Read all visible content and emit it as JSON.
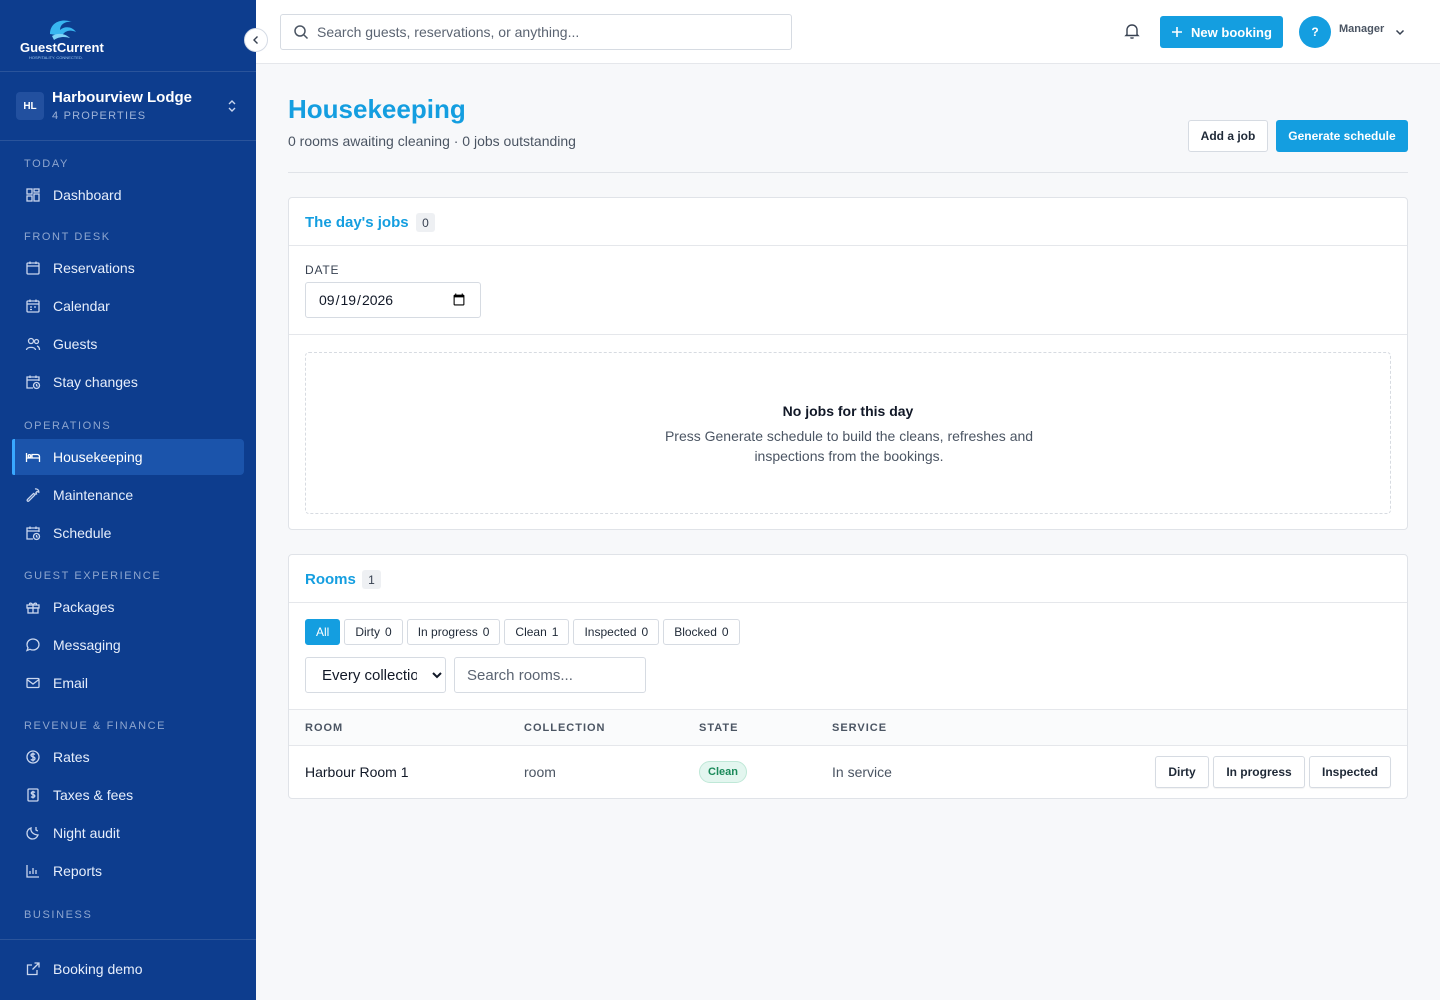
{
  "brand": {
    "name": "GuestCurrent",
    "tagline": "HOSPITALITY. CONNECTED."
  },
  "property": {
    "initials": "HL",
    "name": "Harbourview Lodge",
    "sub": "4 PROPERTIES"
  },
  "nav": {
    "today": "TODAY",
    "dashboard": "Dashboard",
    "front_desk": "FRONT DESK",
    "reservations": "Reservations",
    "calendar": "Calendar",
    "guests": "Guests",
    "stay_changes": "Stay changes",
    "operations": "OPERATIONS",
    "housekeeping": "Housekeeping",
    "maintenance": "Maintenance",
    "schedule": "Schedule",
    "guest_experience": "GUEST EXPERIENCE",
    "packages": "Packages",
    "messaging": "Messaging",
    "email": "Email",
    "revenue_finance": "REVENUE & FINANCE",
    "rates": "Rates",
    "taxes_fees": "Taxes & fees",
    "night_audit": "Night audit",
    "reports": "Reports",
    "business": "BUSINESS",
    "booking_demo": "Booking demo"
  },
  "topbar": {
    "search_placeholder": "Search guests, reservations, or anything...",
    "new_booking": "New booking",
    "avatar": "?",
    "user": "Manager"
  },
  "page": {
    "title": "Housekeeping",
    "subtitle": "0 rooms awaiting cleaning · 0 jobs outstanding",
    "add_job": "Add a job",
    "generate_schedule": "Generate schedule"
  },
  "jobs": {
    "title": "The day's jobs",
    "count": "0",
    "date_label": "DATE",
    "date_value": "2026-09-19",
    "empty_title": "No jobs for this day",
    "empty_text": "Press Generate schedule to build the cleans, refreshes and inspections from the bookings."
  },
  "rooms": {
    "title": "Rooms",
    "count": "1",
    "filters": [
      {
        "label": "All",
        "count": ""
      },
      {
        "label": "Dirty",
        "count": "0"
      },
      {
        "label": "In progress",
        "count": "0"
      },
      {
        "label": "Clean",
        "count": "1"
      },
      {
        "label": "Inspected",
        "count": "0"
      },
      {
        "label": "Blocked",
        "count": "0"
      }
    ],
    "collection_select": "Every collection",
    "search_placeholder": "Search rooms...",
    "columns": [
      "ROOM",
      "COLLECTION",
      "STATE",
      "SERVICE"
    ],
    "rows": [
      {
        "room": "Harbour Room 1",
        "collection": "room",
        "state": "Clean",
        "service": "In service",
        "actions": [
          "Dirty",
          "In progress",
          "Inspected"
        ]
      }
    ]
  },
  "colors": {
    "sidebar": "#0d3d8e",
    "accent": "#149ee0",
    "clean_badge": "#1b8a5a"
  }
}
